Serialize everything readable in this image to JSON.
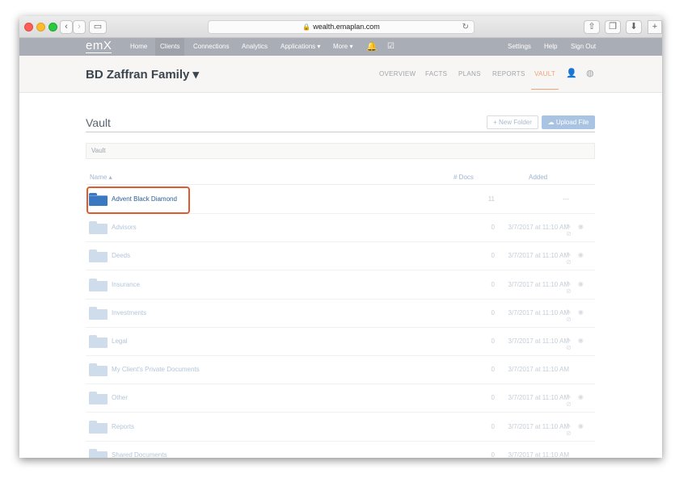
{
  "browser": {
    "url": "wealth.emaplan.com"
  },
  "nav": {
    "logo": "emX",
    "items": [
      "Home",
      "Clients",
      "Connections",
      "Analytics",
      "Applications ▾",
      "More ▾"
    ],
    "right": [
      "Settings",
      "Help",
      "Sign Out"
    ]
  },
  "client": {
    "name": "BD Zaffran Family ▾",
    "tabs": [
      "OVERVIEW",
      "FACTS",
      "PLANS",
      "REPORTS",
      "VAULT"
    ],
    "active_tab": "VAULT"
  },
  "vault": {
    "title": "Vault",
    "new_folder": "+ New Folder",
    "upload": "Upload File",
    "breadcrumb": "Vault",
    "columns": {
      "name": "Name ▴",
      "docs": "# Docs",
      "added": "Added"
    },
    "rows": [
      {
        "name": "Advent Black Diamond",
        "docs": "11",
        "added": "---",
        "highlight": true,
        "actions": ""
      },
      {
        "name": "Advisors",
        "docs": "0",
        "added": "3/7/2017 at 11:10 AM",
        "actions": "✎ ◉ ⊘"
      },
      {
        "name": "Deeds",
        "docs": "0",
        "added": "3/7/2017 at 11:10 AM",
        "actions": "✎ ◉ ⊘"
      },
      {
        "name": "Insurance",
        "docs": "0",
        "added": "3/7/2017 at 11:10 AM",
        "actions": "✎ ◉ ⊘"
      },
      {
        "name": "Investments",
        "docs": "0",
        "added": "3/7/2017 at 11:10 AM",
        "actions": "✎ ◉ ⊘"
      },
      {
        "name": "Legal",
        "docs": "0",
        "added": "3/7/2017 at 11:10 AM",
        "actions": "✎ ◉ ⊘"
      },
      {
        "name": "My Client's Private Documents",
        "docs": "0",
        "added": "3/7/2017 at 11:10 AM",
        "actions": ""
      },
      {
        "name": "Other",
        "docs": "0",
        "added": "3/7/2017 at 11:10 AM",
        "actions": "✎ ◉ ⊘"
      },
      {
        "name": "Reports",
        "docs": "0",
        "added": "3/7/2017 at 11:10 AM",
        "actions": "✎ ◉ ⊘"
      },
      {
        "name": "Shared Documents",
        "docs": "0",
        "added": "3/7/2017 at 11:10 AM",
        "actions": ""
      }
    ]
  },
  "colors": {
    "nav_bg": "#a9adb5",
    "accent": "#f0a47a",
    "folder": "#3a78c2",
    "highlight_box": "#e05a2e"
  }
}
